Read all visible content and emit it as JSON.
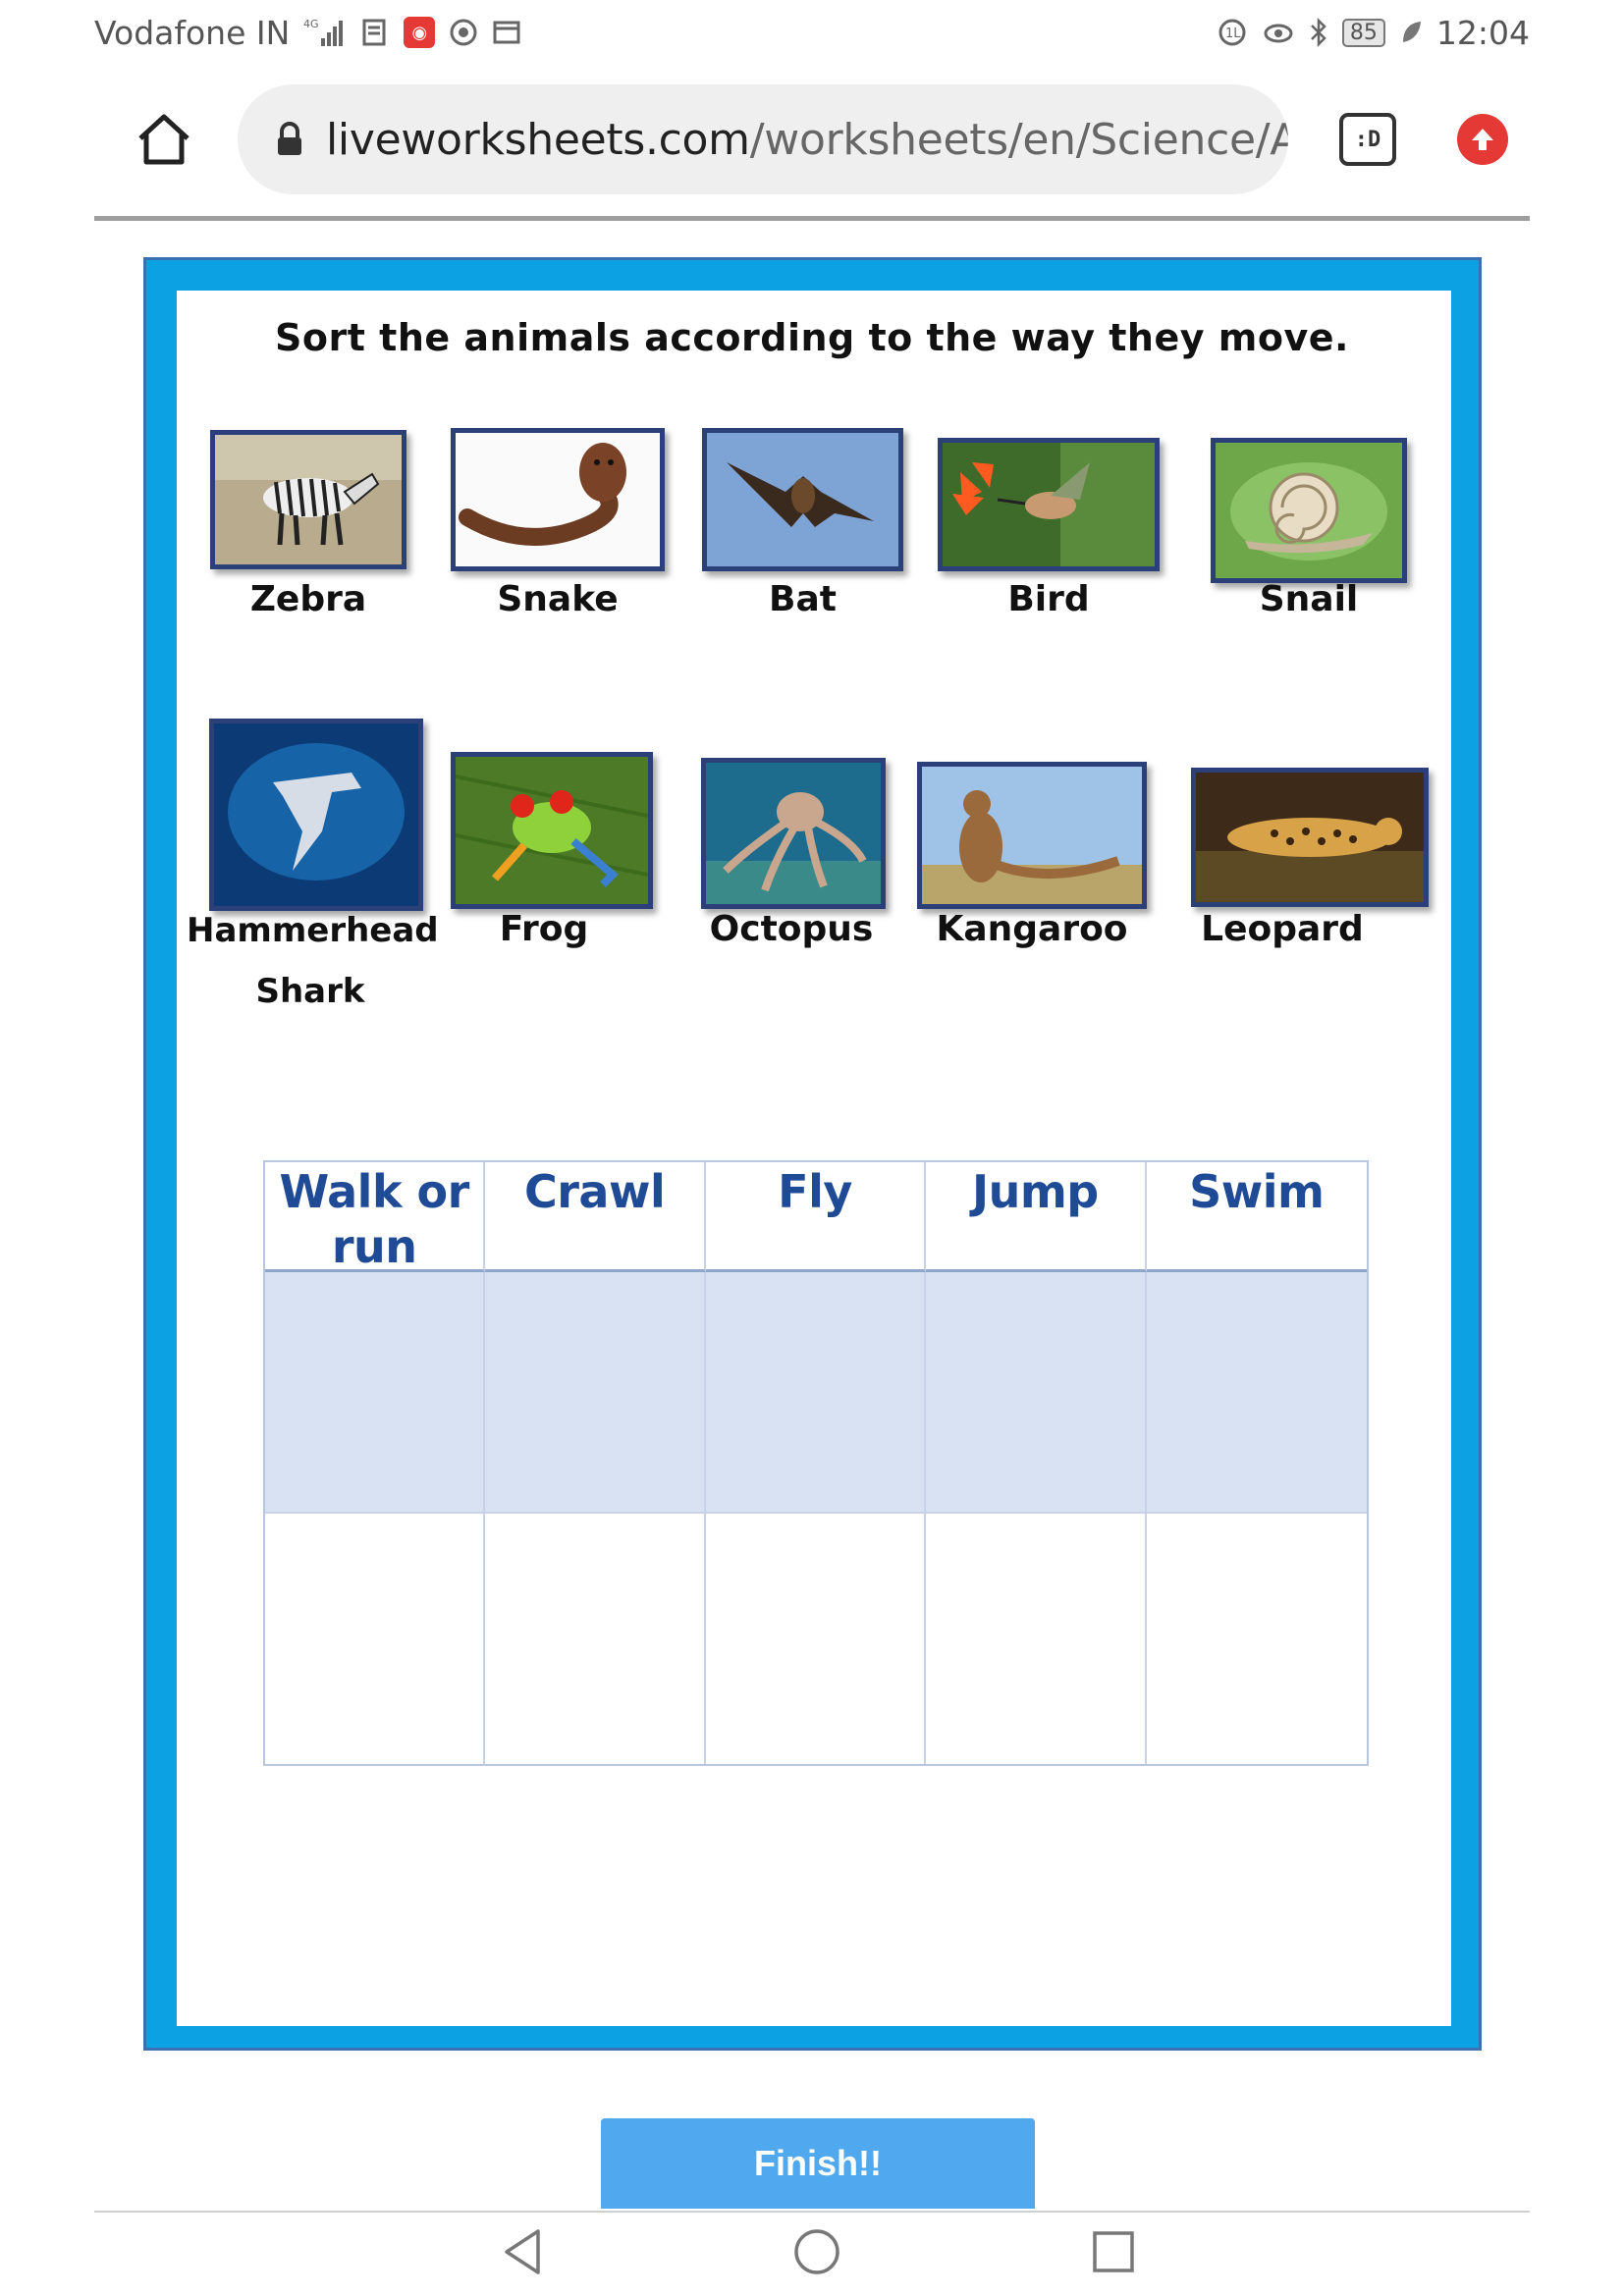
{
  "status_bar": {
    "carrier": "Vodafone IN",
    "network": "4G",
    "battery": "85",
    "time": "12:04"
  },
  "browser": {
    "url_domain": "liveworksheets.com",
    "url_path": "/worksheets/en/Science/An",
    "tabs_label": ":D"
  },
  "worksheet": {
    "title": "Sort the animals according to the way they move.",
    "animals": [
      {
        "name": "Zebra"
      },
      {
        "name": "Snake"
      },
      {
        "name": "Bat"
      },
      {
        "name": "Bird"
      },
      {
        "name": "Snail"
      },
      {
        "name": "Hammerhead",
        "name_line2": "Shark"
      },
      {
        "name": "Frog"
      },
      {
        "name": "Octopus"
      },
      {
        "name": "Kangaroo"
      },
      {
        "name": "Leopard"
      }
    ],
    "table": {
      "columns": [
        {
          "line1": "Walk or",
          "line2": "run"
        },
        {
          "line1": "Crawl"
        },
        {
          "line1": "Fly"
        },
        {
          "line1": "Jump"
        },
        {
          "line1": "Swim"
        }
      ]
    }
  },
  "finish_label": "Finish!!",
  "colors": {
    "frame": "#0ca1e3",
    "header_text": "#1f4a96",
    "table_shade": "#d9e2f3",
    "finish_button": "#50a8ee"
  }
}
